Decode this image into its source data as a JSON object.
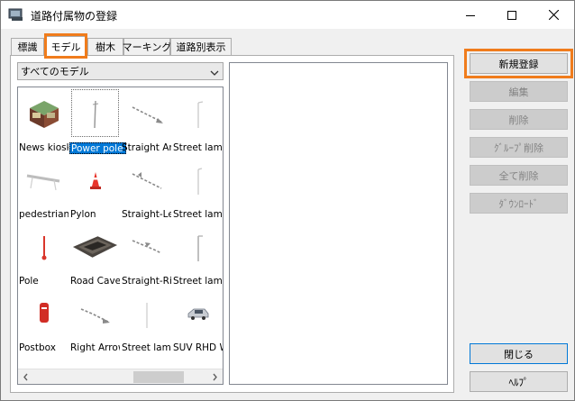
{
  "window": {
    "title": "道路付属物の登録"
  },
  "tabs": [
    {
      "label": "標識"
    },
    {
      "label": "モデル"
    },
    {
      "label": "樹木"
    },
    {
      "label": "マーキング"
    },
    {
      "label": "道路別表示"
    }
  ],
  "filter": {
    "selected": "すべてのモデル"
  },
  "models": [
    {
      "label": "News kiosk"
    },
    {
      "label": "Power pole"
    },
    {
      "label": "Straight Arr"
    },
    {
      "label": "Street lamp"
    },
    {
      "label": "pedestrian"
    },
    {
      "label": "Pylon"
    },
    {
      "label": "Straight-Le"
    },
    {
      "label": "Street lamp"
    },
    {
      "label": "Pole"
    },
    {
      "label": "Road Cave"
    },
    {
      "label": "Straight-Ri"
    },
    {
      "label": "Street lamp"
    },
    {
      "label": "Postbox"
    },
    {
      "label": "Right Arrow"
    },
    {
      "label": "Street lamp"
    },
    {
      "label": "SUV RHD W"
    }
  ],
  "buttons": {
    "register": "新規登録",
    "edit": "編集",
    "delete": "削除",
    "group_delete": "ｸﾞﾙｰﾌﾟ削除",
    "delete_all": "全て削除",
    "download": "ﾀﾞｳﾝﾛｰﾄﾞ",
    "close": "閉じる",
    "help": "ﾍﾙﾌﾟ"
  },
  "colors": {
    "highlight": "#f07c1c",
    "selection": "#0078d7"
  }
}
